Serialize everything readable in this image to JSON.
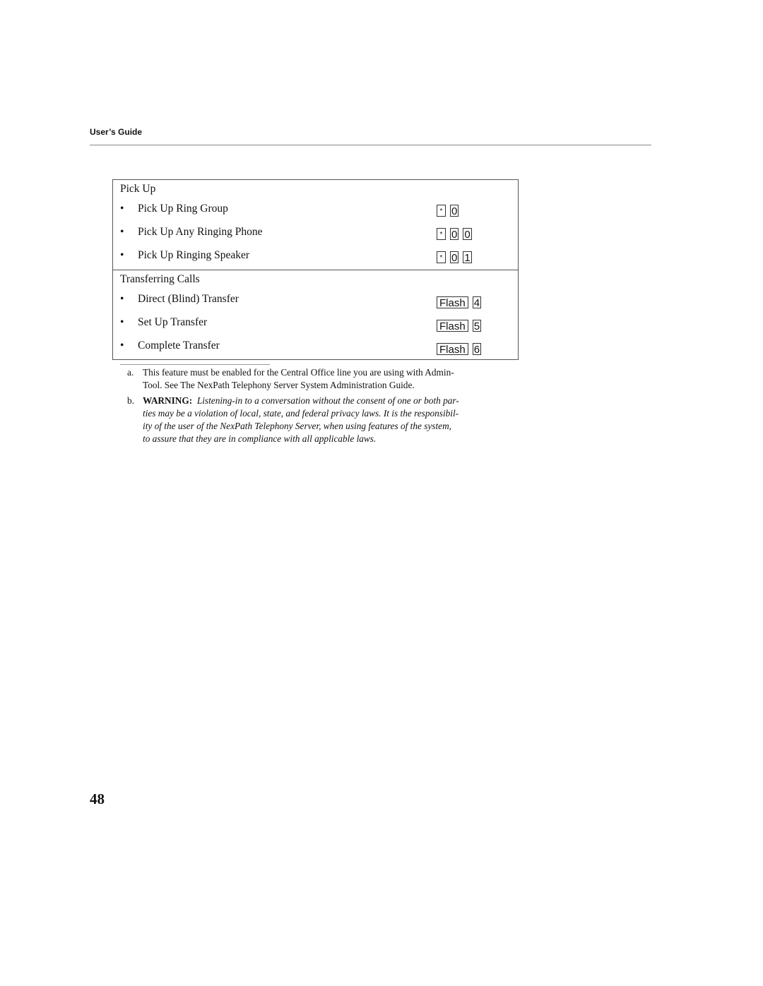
{
  "header": {
    "title": "User’s Guide"
  },
  "table": {
    "sections": [
      {
        "title": "Pick Up",
        "rows": [
          {
            "label": "Pick Up Ring Group",
            "keys": [
              "*",
              "0"
            ]
          },
          {
            "label": "Pick Up Any Ringing Phone",
            "keys": [
              "*",
              "0",
              "0"
            ]
          },
          {
            "label": "Pick Up Ringing Speaker",
            "keys": [
              "*",
              "0",
              "1"
            ]
          }
        ]
      },
      {
        "title": "Transferring Calls",
        "rows": [
          {
            "label": "Direct (Blind) Transfer",
            "keys": [
              "Flash",
              "4"
            ]
          },
          {
            "label": "Set Up Transfer",
            "keys": [
              "Flash",
              "5"
            ]
          },
          {
            "label": "Complete Transfer",
            "keys": [
              "Flash",
              "6"
            ]
          }
        ]
      }
    ]
  },
  "footnotes": {
    "a": {
      "mark": "a.",
      "line1": "This feature must be enabled for the Central Office line you are using with Admin-",
      "line2": "Tool.  See The NexPath Telephony Server System Administration Guide."
    },
    "b": {
      "mark": "b.",
      "warning_label": "WARNING:",
      "line1": "Listening-in to a conversation without the consent of one or both par-",
      "line2": "ties may be a violation of local, state, and federal privacy laws.  It is the responsibil-",
      "line3": "ity of the user of the NexPath Telephony Server, when using features of the system,",
      "line4": "to assure that they are in compliance with all applicable laws."
    }
  },
  "page_number": "48"
}
